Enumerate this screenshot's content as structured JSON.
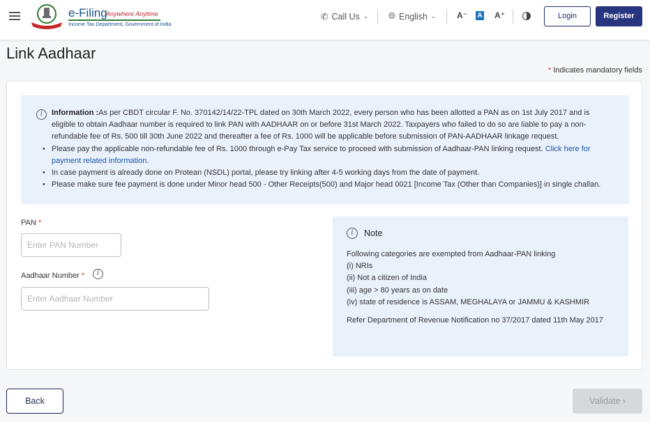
{
  "header": {
    "logo_title": "e-Filing",
    "logo_tagline": "Anywhere Anytime",
    "logo_subtitle": "Income Tax Department, Government of India",
    "call_us": "Call Us",
    "language": "English",
    "font_decrease": "A⁻",
    "font_default": "A",
    "font_increase": "A⁺",
    "login": "Login",
    "register": "Register"
  },
  "page": {
    "title": "Link Aadhaar",
    "mandatory_star": "*",
    "mandatory_note": " Indicates mandatory fields"
  },
  "info": {
    "label": "Information :",
    "intro": "As per CBDT circular F. No. 370142/14/22-TPL dated on 30th March 2022, every person who has been allotted a PAN as on 1st July 2017 and is eligible to obtain Aadhaar number is required to link PAN with AADHAAR on or before 31st March 2022. Taxpayers who failed to do so are liable to pay a non-refundable fee of Rs. 500 till 30th June 2022 and thereafter a fee of Rs. 1000 will be applicable before submission of PAN-AADHAAR linkage request.",
    "bullets": [
      "Please pay the applicable non-refundable fee of Rs. 1000 through e-Pay Tax service to proceed with submission of Aadhaar-PAN linking request. Click here for payment related information. ",
      "In case payment is already done on Protean (NSDL) portal, please try linking after 4-5 working days from the date of payment.",
      "Please make sure fee payment is done under Minor head 500 - Other Receipts(500) and Major head 0021 [Income Tax (Other than Companies)] in single challan."
    ],
    "link_text": "Click here for payment related information."
  },
  "form": {
    "pan_label": "PAN",
    "pan_placeholder": "Enter PAN Number",
    "pan_value": "",
    "aadhaar_label": "Aadhaar Number",
    "aadhaar_placeholder": "Enter Aadhaar Number",
    "aadhaar_value": "",
    "required_mark": "*"
  },
  "note": {
    "title": "Note",
    "heading": "Following categories are exempted from Aadhaar-PAN linking",
    "items": [
      "(i) NRIs",
      "(ii) Not a citizen of India",
      "(iii) age > 80 years as on date",
      "(iv) state of residence is ASSAM, MEGHALAYA or JAMMU & KASHMIR"
    ],
    "reference": "Refer Department of Revenue Notification no 37/2017 dated 11th May 2017"
  },
  "actions": {
    "back": "Back",
    "validate": "Validate ›"
  },
  "icons": {
    "info": "i"
  },
  "colors": {
    "primary": "#27347f",
    "link": "#1b55a7",
    "info_bg": "#e9f1fb",
    "required": "#d32f2f",
    "disabled_bg": "#d7d8da"
  }
}
